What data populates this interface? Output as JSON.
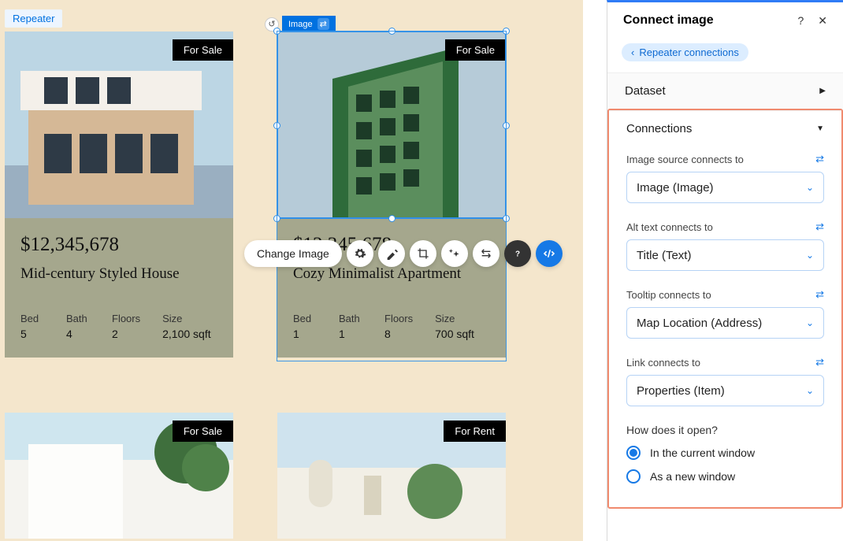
{
  "canvas": {
    "repeater_label": "Repeater",
    "selected_element_label": "Image",
    "toolbar": {
      "change_image": "Change Image",
      "icons": [
        "settings",
        "brush",
        "crop",
        "magic",
        "stretch",
        "help",
        "bind"
      ]
    }
  },
  "cards": [
    {
      "status": "For Sale",
      "price": "$12,345,678",
      "title": "Mid-century Styled House",
      "specs": [
        {
          "label": "Bed",
          "value": "5"
        },
        {
          "label": "Bath",
          "value": "4"
        },
        {
          "label": "Floors",
          "value": "2"
        },
        {
          "label": "Size",
          "value": "2,100 sqft"
        }
      ]
    },
    {
      "status": "For Sale",
      "price": "$12,345,678",
      "title": "Cozy Minimalist Apartment",
      "specs": [
        {
          "label": "Bed",
          "value": "1"
        },
        {
          "label": "Bath",
          "value": "1"
        },
        {
          "label": "Floors",
          "value": "8"
        },
        {
          "label": "Size",
          "value": "700 sqft"
        }
      ]
    },
    {
      "status": "For Sale",
      "price": "",
      "title": "",
      "specs": []
    },
    {
      "status": "For Rent",
      "price": "",
      "title": "",
      "specs": []
    }
  ],
  "panel": {
    "title": "Connect image",
    "breadcrumb": "Repeater connections",
    "sections": {
      "dataset": "Dataset",
      "connections": "Connections"
    },
    "fields": {
      "image_source": {
        "label": "Image source connects to",
        "value": "Image (Image)"
      },
      "alt_text": {
        "label": "Alt text connects to",
        "value": "Title (Text)"
      },
      "tooltip": {
        "label": "Tooltip connects to",
        "value": "Map Location (Address)"
      },
      "link": {
        "label": "Link connects to",
        "value": "Properties (Item)"
      }
    },
    "open_question": "How does it open?",
    "open_options": {
      "current": "In the current window",
      "new": "As a new window"
    },
    "open_selected": "current"
  }
}
